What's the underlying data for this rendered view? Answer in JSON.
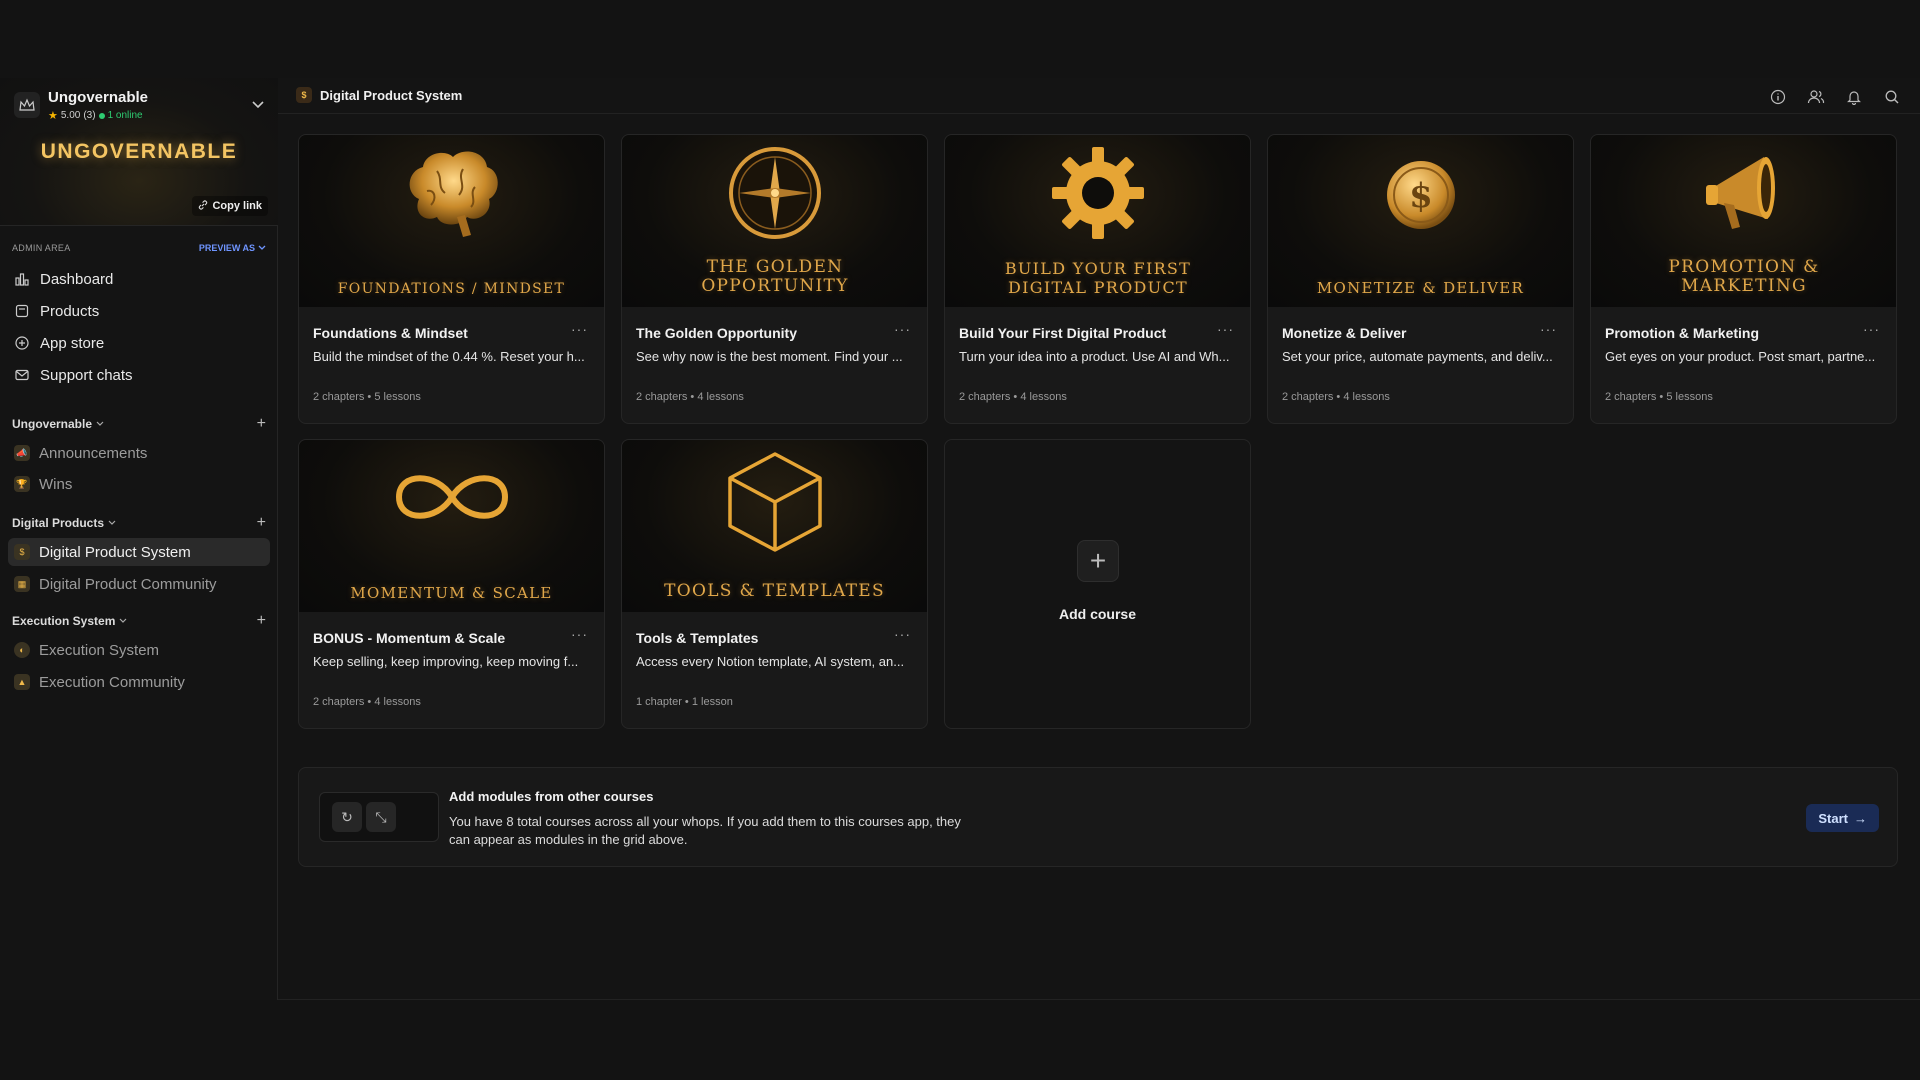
{
  "workspace": {
    "name": "Ungovernable",
    "rating": "5.00",
    "reviews": "(3)",
    "online": "1 online",
    "logo_text": "UNGOVERNABLE",
    "copy_link": "Copy link"
  },
  "sidebar": {
    "admin_label": "ADMIN AREA",
    "preview_as": "PREVIEW AS",
    "admin_items": [
      {
        "label": "Dashboard",
        "icon": "dashboard-icon"
      },
      {
        "label": "Products",
        "icon": "products-icon"
      },
      {
        "label": "App store",
        "icon": "app-store-icon"
      },
      {
        "label": "Support chats",
        "icon": "support-chats-icon"
      }
    ],
    "sections": [
      {
        "title": "Ungovernable",
        "items": [
          {
            "label": "Announcements"
          },
          {
            "label": "Wins"
          }
        ]
      },
      {
        "title": "Digital Products",
        "items": [
          {
            "label": "Digital Product System"
          },
          {
            "label": "Digital Product Community"
          }
        ]
      },
      {
        "title": "Execution System",
        "items": [
          {
            "label": "Execution System"
          },
          {
            "label": "Execution Community"
          }
        ]
      }
    ]
  },
  "header": {
    "breadcrumb": "Digital Product System",
    "icons": [
      "info-icon",
      "users-icon",
      "bell-icon",
      "search-icon"
    ]
  },
  "courses": [
    {
      "thumb_title": "FOUNDATIONS / MINDSET",
      "title": "Foundations & Mindset",
      "desc": "Build the mindset of the 0.44 %. Reset your h...",
      "chapters": "2 chapters",
      "lessons": "5 lessons"
    },
    {
      "thumb_title": "THE GOLDEN OPPORTUNITY",
      "title": "The Golden Opportunity",
      "desc": "See why now is the best moment. Find your ...",
      "chapters": "2 chapters",
      "lessons": "4 lessons"
    },
    {
      "thumb_title": "BUILD YOUR FIRST DIGITAL PRODUCT",
      "title": "Build Your First Digital Product",
      "desc": "Turn your idea into a product. Use AI and Wh...",
      "chapters": "2 chapters",
      "lessons": "4 lessons"
    },
    {
      "thumb_title": "MONETIZE & DELIVER",
      "title": "Monetize & Deliver",
      "desc": "Set your price, automate payments, and deliv...",
      "chapters": "2 chapters",
      "lessons": "4 lessons"
    },
    {
      "thumb_title": "PROMOTION & MARKETING",
      "title": "Promotion & Marketing",
      "desc": "Get eyes on your product. Post smart, partne...",
      "chapters": "2 chapters",
      "lessons": "5 lessons"
    },
    {
      "thumb_title": "MOMENTUM & SCALE",
      "title": "BONUS - Momentum & Scale",
      "desc": "Keep selling, keep improving, keep moving f...",
      "chapters": "2 chapters",
      "lessons": "4 lessons"
    },
    {
      "thumb_title": "TOOLS & TEMPLATES",
      "title": "Tools & Templates",
      "desc": "Access every Notion template, AI system, an...",
      "chapters": "1 chapter",
      "lessons": "1 lesson"
    }
  ],
  "add_course": {
    "label": "Add course"
  },
  "banner": {
    "title": "Add modules from other courses",
    "text": "You have 8 total courses across all your whops. If you add them to this courses app, they can appear as modules in the grid above.",
    "button": "Start"
  },
  "colors": {
    "accent_gold": "#e0a74a",
    "link_blue": "#6f95ff",
    "online_green": "#2ecc71"
  }
}
